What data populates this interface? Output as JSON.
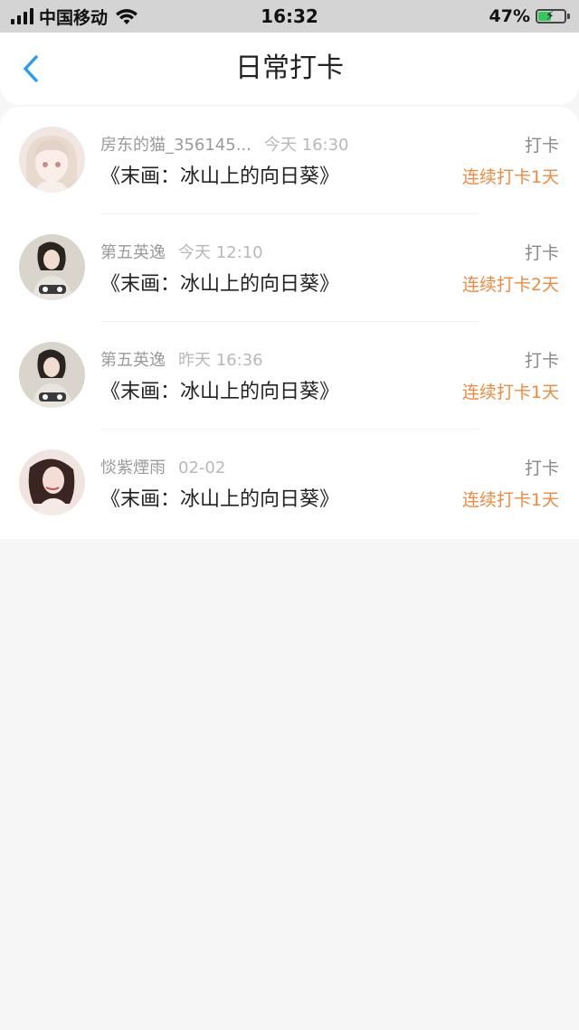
{
  "status_bar": {
    "carrier": "中国移动",
    "time": "16:32",
    "battery": "47%",
    "battery_level": 0.47
  },
  "header": {
    "title": "日常打卡"
  },
  "checkins": [
    {
      "user": "房东的猫_356145...",
      "time": "今天 16:30",
      "book": "《末画：冰山上的向日葵》",
      "action": "打卡",
      "streak": "连续打卡1天"
    },
    {
      "user": "第五英逸",
      "time": "今天 12:10",
      "book": "《末画：冰山上的向日葵》",
      "action": "打卡",
      "streak": "连续打卡2天"
    },
    {
      "user": "第五英逸",
      "time": "昨天 16:36",
      "book": "《末画：冰山上的向日葵》",
      "action": "打卡",
      "streak": "连续打卡1天"
    },
    {
      "user": "惔紫煙雨",
      "time": "02-02",
      "book": "《末画：冰山上的向日葵》",
      "action": "打卡",
      "streak": "连续打卡1天"
    }
  ],
  "colors": {
    "accent": "#2b9df4",
    "streak": "#f08a3e",
    "status_bar_bg": "#d4d4d4"
  }
}
